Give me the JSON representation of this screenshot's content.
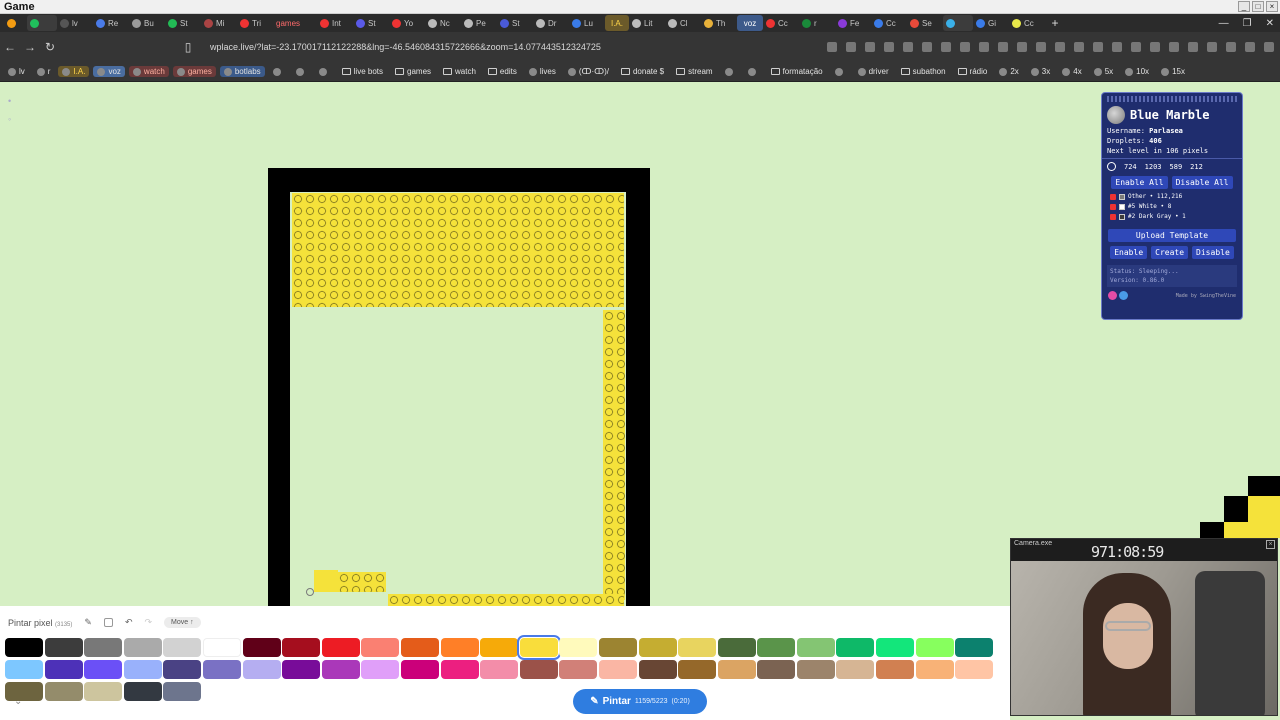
{
  "window": {
    "title": "Game"
  },
  "tabs": [
    {
      "label": "",
      "color": "#f39c12"
    },
    {
      "label": "",
      "color": "#20c05c",
      "active": true
    },
    {
      "label": "lv",
      "color": "#555555"
    },
    {
      "label": "Re",
      "color": "#4a7be8"
    },
    {
      "label": "Bu",
      "color": "#9a9a9a"
    },
    {
      "label": "St",
      "color": "#22bb55"
    },
    {
      "label": "Mi",
      "color": "#aa4444"
    },
    {
      "label": "Tri",
      "color": "#e33"
    },
    {
      "label": "games",
      "color": "",
      "style": "wide"
    },
    {
      "label": "Int",
      "color": "#e33"
    },
    {
      "label": "St",
      "color": "#5a5ae8"
    },
    {
      "label": "Yo",
      "color": "#e33"
    },
    {
      "label": "Nc",
      "color": "#bbbbbb"
    },
    {
      "label": "Pe",
      "color": "#bbbbbb"
    },
    {
      "label": "St",
      "color": "#4a5ad8"
    },
    {
      "label": "Dr",
      "color": "#bbbbbb"
    },
    {
      "label": "Lu",
      "color": "#3a7be8"
    },
    {
      "label": "I.A.",
      "color": "",
      "style": "ia"
    },
    {
      "label": "Lit",
      "color": "#bbbbbb"
    },
    {
      "label": "Cl",
      "color": "#bbbbbb"
    },
    {
      "label": "Th",
      "color": "#e8b13a"
    },
    {
      "label": "voz",
      "color": "",
      "style": "voz"
    },
    {
      "label": "Cc",
      "color": "#e33"
    },
    {
      "label": "r",
      "color": "#1a8a3a"
    },
    {
      "label": "Fe",
      "color": "#8a3ad8"
    },
    {
      "label": "Cc",
      "color": "#3a7be8"
    },
    {
      "label": "Se",
      "color": "#e84a3a"
    },
    {
      "label": "",
      "color": "#3ab0e8",
      "active": true
    },
    {
      "label": "Gi",
      "color": "#3a7be8"
    },
    {
      "label": "Cc",
      "color": "#e8e84a"
    }
  ],
  "address": {
    "url": "wplace.live/?lat=-23.170017112122288&lng=-46.546084315722666&zoom=14.077443512324725"
  },
  "bookmarks": [
    {
      "label": "lv",
      "style": ""
    },
    {
      "label": "r",
      "style": ""
    },
    {
      "label": "I.A.",
      "style": "hl-ia"
    },
    {
      "label": "voz",
      "style": "hl-voz"
    },
    {
      "label": "watch",
      "style": "hl-watch"
    },
    {
      "label": "games",
      "style": "hl-games"
    },
    {
      "label": "botlabs",
      "style": "hl-botlabs"
    },
    {
      "label": "",
      "style": ""
    },
    {
      "label": "",
      "style": ""
    },
    {
      "label": "",
      "style": ""
    },
    {
      "label": "live bots",
      "style": "folder"
    },
    {
      "label": "games",
      "style": "folder"
    },
    {
      "label": "watch",
      "style": "folder"
    },
    {
      "label": "edits",
      "style": "folder"
    },
    {
      "label": "lives",
      "style": ""
    },
    {
      "label": "(ↀ·ↀ)/",
      "style": ""
    },
    {
      "label": "donate $",
      "style": "folder"
    },
    {
      "label": "stream",
      "style": "folder"
    },
    {
      "label": "",
      "style": ""
    },
    {
      "label": "",
      "style": ""
    },
    {
      "label": "formatação",
      "style": "folder"
    },
    {
      "label": "",
      "style": ""
    },
    {
      "label": "driver",
      "style": ""
    },
    {
      "label": "subathon",
      "style": "folder"
    },
    {
      "label": "rádio",
      "style": "folder"
    },
    {
      "label": "2x",
      "style": ""
    },
    {
      "label": "3x",
      "style": ""
    },
    {
      "label": "4x",
      "style": ""
    },
    {
      "label": "5x",
      "style": ""
    },
    {
      "label": "10x",
      "style": ""
    },
    {
      "label": "15x",
      "style": ""
    }
  ],
  "blue_marble": {
    "title": "Blue Marble",
    "username_label": "Username:",
    "username": "Parlasea",
    "droplets_label": "Droplets:",
    "droplets": "406",
    "next_level": "Next level in 106 pixels",
    "coords": [
      "724",
      "1203",
      "589",
      "212"
    ],
    "enable_all": "Enable All",
    "disable_all": "Disable All",
    "colors": [
      {
        "label": "Other • 112,216",
        "swatch": "#7a7a7a"
      },
      {
        "label": "#5 White • 8",
        "swatch": "#ffffff"
      },
      {
        "label": "#2 Dark Gray • 1",
        "swatch": "#3c3c3c"
      }
    ],
    "upload_template": "Upload Template",
    "enable": "Enable",
    "create": "Create",
    "disable": "Disable",
    "status_line1": "Status: Sleeping...",
    "status_line2": "Version: 0.86.0",
    "made_by": "Made by SwingTheVine"
  },
  "webcam": {
    "label": "Camera.exe",
    "timer": "971:08:59"
  },
  "paint_bar": {
    "title": "Pintar pixel",
    "count_small": "(3135)",
    "move_label": "Move ↑",
    "selected_index": 13,
    "colors": [
      "#000000",
      "#3c3c3c",
      "#787878",
      "#aaaaaa",
      "#d2d2d2",
      "#ffffff",
      "#600018",
      "#a50e1e",
      "#ed1c24",
      "#fa8072",
      "#e45c1a",
      "#ff7f27",
      "#f6aa09",
      "#f9dd3b",
      "#fffabc",
      "#9c8431",
      "#c5ad31",
      "#e8d45f",
      "#4a6b3a",
      "#5a944a",
      "#84c573",
      "#0eb968",
      "#13e67b",
      "#87ff5e",
      "#0c816e",
      "#7dc7ff",
      "#4d31b8",
      "#6b50f6",
      "#99b1fb",
      "#4a4284",
      "#7a71c4",
      "#b5aef1",
      "#780c99",
      "#aa38b9",
      "#e09ff9",
      "#cb007a",
      "#ec1f80",
      "#f38da9",
      "#9b5249",
      "#d18078",
      "#fab6a4",
      "#684634",
      "#95682a",
      "#dba463",
      "#7b6352",
      "#9c846b",
      "#d6b594",
      "#d18051",
      "#f8b277",
      "#ffc5a5",
      "#6d643f",
      "#948c6b",
      "#cdc59e",
      "#333941",
      "#6d758d"
    ],
    "paint_label": "Pintar",
    "paint_count": "1159/5223",
    "paint_timer": "(0:20)"
  }
}
